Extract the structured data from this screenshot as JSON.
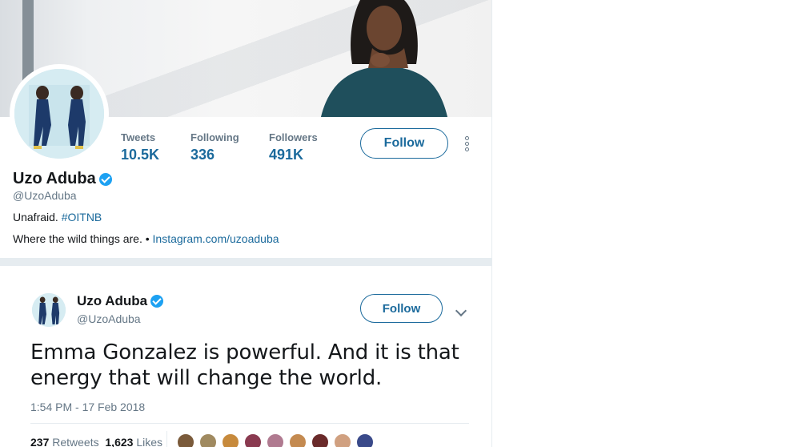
{
  "profile": {
    "display_name": "Uzo Aduba",
    "handle": "@UzoAduba",
    "bio_text": "Unafraid.",
    "bio_hashtag": "#OITNB",
    "location_text": "Where the wild things are. •",
    "website": "Instagram.com/uzoaduba",
    "stats": [
      {
        "label": "Tweets",
        "value": "10.5K"
      },
      {
        "label": "Following",
        "value": "336"
      },
      {
        "label": "Followers",
        "value": "491K"
      }
    ],
    "follow_label": "Follow"
  },
  "tweet": {
    "display_name": "Uzo Aduba",
    "handle": "@UzoAduba",
    "follow_label": "Follow",
    "text": "Emma Gonzalez is powerful. And it is that energy that will change the world.",
    "timestamp": "1:54 PM - 17 Feb 2018",
    "retweets_count": "237",
    "retweets_label": "Retweets",
    "likes_count": "1,623",
    "likes_label": "Likes"
  },
  "colors": {
    "accent": "#1b6a9c",
    "verified": "#1da1f2",
    "muted": "#657786"
  },
  "likers": [
    "#7a5a3a",
    "#a08a60",
    "#c78a3c",
    "#8a3a50",
    "#b07a90",
    "#c48a50",
    "#6a2a2a",
    "#d0a080",
    "#3a4a8a"
  ]
}
